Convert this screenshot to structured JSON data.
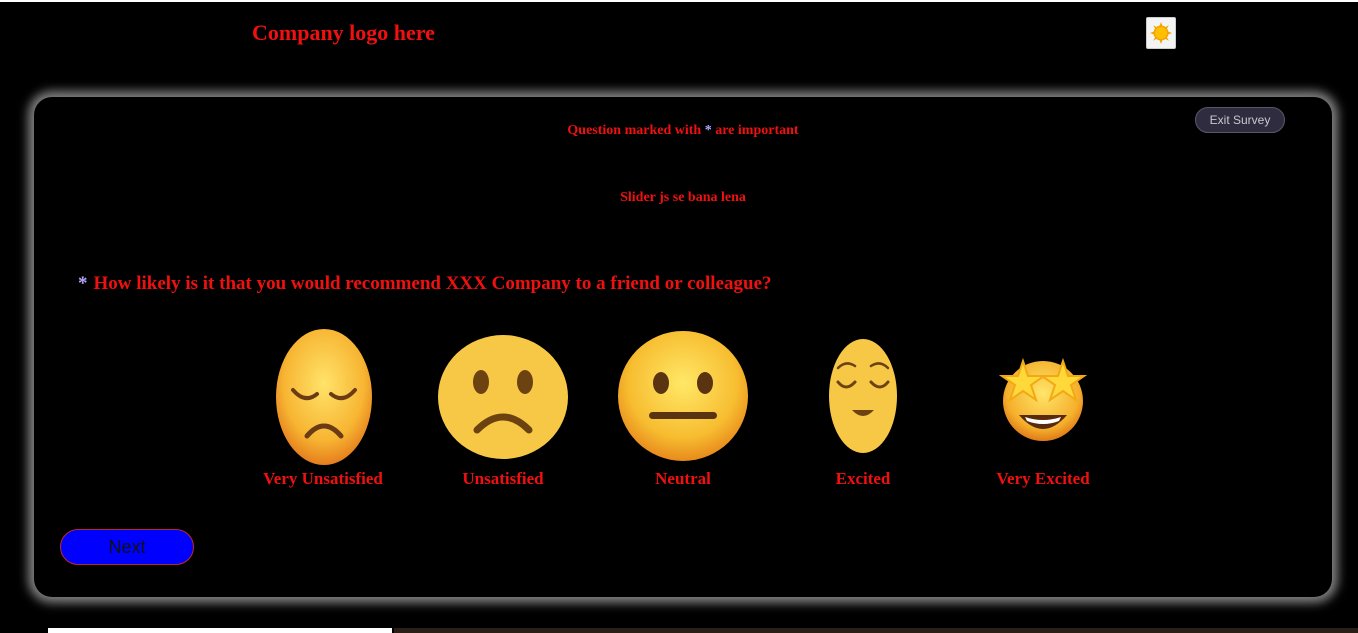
{
  "header": {
    "logo_text": "Company logo here",
    "theme_icon": "sun-icon"
  },
  "survey": {
    "exit_label": "Exit Survey",
    "note_prefix": "Question marked with",
    "note_star": "*",
    "note_suffix": "are important",
    "slider_note": "Slider js se bana lena",
    "question_star": "*",
    "question": "How likely is it that you would recommend XXX Company to a friend or colleague?",
    "options": [
      {
        "label": "Very Unsatisfied",
        "icon": "disappointed-face-icon"
      },
      {
        "label": "Unsatisfied",
        "icon": "frowning-face-icon"
      },
      {
        "label": "Neutral",
        "icon": "neutral-face-icon"
      },
      {
        "label": "Excited",
        "icon": "relieved-face-icon"
      },
      {
        "label": "Very Excited",
        "icon": "star-struck-face-icon"
      }
    ],
    "next_label": "Next"
  },
  "colors": {
    "background": "#000000",
    "text_accent": "#f01010",
    "star": "#b9a8ff",
    "next_button": "#0000ff",
    "exit_button": "#2e2c3e"
  }
}
